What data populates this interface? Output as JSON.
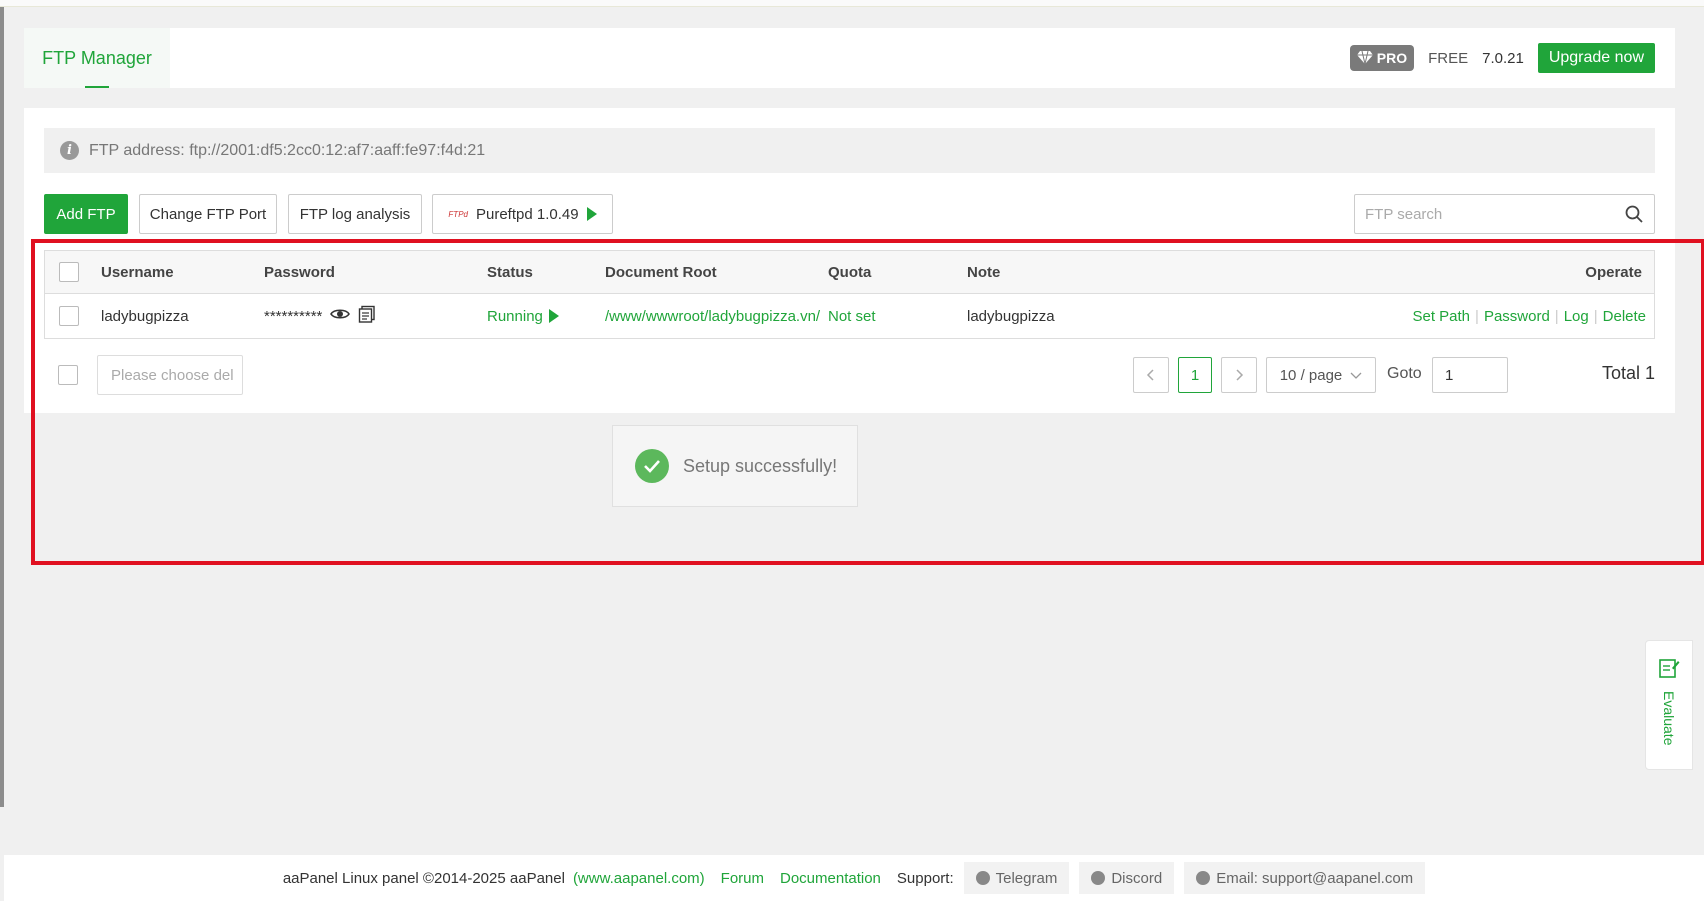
{
  "header": {
    "tab_label": "FTP Manager",
    "pro_label": "PRO",
    "free_label": "FREE",
    "version": "7.0.21",
    "upgrade_label": "Upgrade now"
  },
  "alert": {
    "text": "FTP address: ftp://2001:df5:2cc0:12:af7:aaff:fe97:f4d:21"
  },
  "toolbar": {
    "add_ftp": "Add FTP",
    "change_port": "Change FTP Port",
    "log_analysis": "FTP log analysis",
    "pureftpd_logo": "FTPd",
    "pureftpd": "Pureftpd 1.0.49",
    "search_placeholder": "FTP search"
  },
  "table": {
    "columns": [
      "Username",
      "Password",
      "Status",
      "Document Root",
      "Quota",
      "Note",
      "Operate"
    ],
    "rows": [
      {
        "username": "ladybugpizza",
        "password": "**********",
        "status": "Running",
        "doc_root": "/www/wwwroot/ladybugpizza.vn/",
        "quota": "Not set",
        "note": "ladybugpizza",
        "ops": [
          "Set Path",
          "Password",
          "Log",
          "Delete"
        ]
      }
    ]
  },
  "pager": {
    "del_placeholder": "Please choose del",
    "current_page": "1",
    "per_page": "10 / page",
    "goto_label": "Goto",
    "goto_value": "1",
    "total": "Total 1"
  },
  "toast": {
    "text": "Setup successfully!"
  },
  "evaluate": {
    "label": "Evaluate"
  },
  "footer": {
    "copyright": "aaPanel Linux panel ©2014-2025 aaPanel",
    "site": "(www.aapanel.com)",
    "forum": "Forum",
    "docs": "Documentation",
    "support": "Support:",
    "telegram": "Telegram",
    "discord": "Discord",
    "email": "Email: support@aapanel.com"
  },
  "colors": {
    "accent": "#20a53a",
    "highlight_frame": "#e01020"
  }
}
